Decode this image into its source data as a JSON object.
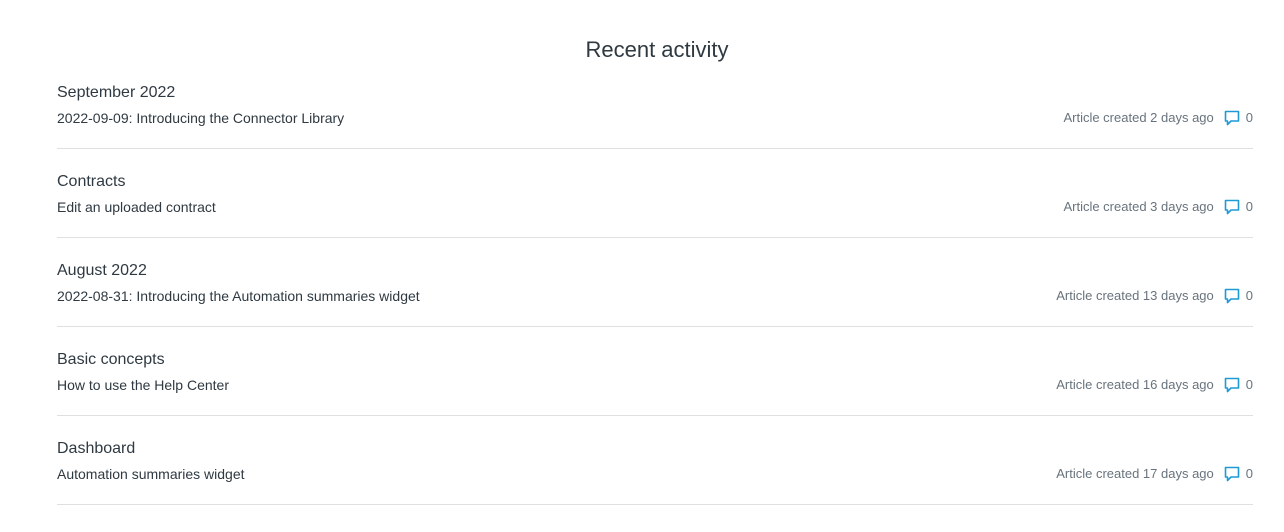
{
  "section": {
    "title": "Recent activity"
  },
  "activities": [
    {
      "parent": "September 2022",
      "title": "2022-09-09: Introducing the Connector Library",
      "meta": "Article created 2 days ago",
      "comments": "0"
    },
    {
      "parent": "Contracts",
      "title": "Edit an uploaded contract",
      "meta": "Article created 3 days ago",
      "comments": "0"
    },
    {
      "parent": "August 2022",
      "title": "2022-08-31: Introducing the Automation summaries widget",
      "meta": "Article created 13 days ago",
      "comments": "0"
    },
    {
      "parent": "Basic concepts",
      "title": "How to use the Help Center",
      "meta": "Article created 16 days ago",
      "comments": "0"
    },
    {
      "parent": "Dashboard",
      "title": "Automation summaries widget",
      "meta": "Article created 17 days ago",
      "comments": "0"
    }
  ],
  "icons": {
    "comment": "comment-bubble-icon"
  },
  "colors": {
    "text": "#2f3941",
    "muted": "#68737d",
    "accent": "#1f9ad6",
    "divider": "#e0e0e0"
  }
}
